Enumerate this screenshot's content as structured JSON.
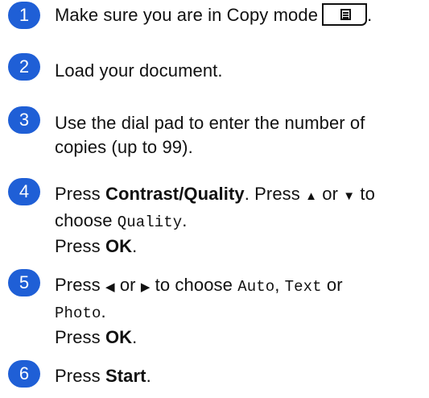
{
  "steps": [
    {
      "number": "1",
      "text_before": "Make sure you are in Copy mode",
      "button_icon": "copy-mode-icon",
      "text_after": "."
    },
    {
      "number": "2",
      "text": "Load your document."
    },
    {
      "number": "3",
      "line1": "Use the dial pad to enter the number of",
      "line2": "copies (up to 99)."
    },
    {
      "number": "4",
      "press": "Press",
      "button": "Contrast/Quality",
      "sep": ". Press",
      "up": "▲",
      "or": "or",
      "down": "▼",
      "to": "to",
      "choose": "choose",
      "option": "Quality",
      "period": ".",
      "press2": "Press",
      "ok": "OK",
      "period2": "."
    },
    {
      "number": "5",
      "press": "Press",
      "left": "◀",
      "or": "or",
      "right": "▶",
      "to_choose": "to choose",
      "opt1": "Auto",
      "comma": ",",
      "opt2": "Text",
      "or2": "or",
      "opt3": "Photo",
      "period": ".",
      "press2": "Press",
      "ok": "OK",
      "period2": "."
    },
    {
      "number": "6",
      "press": "Press",
      "button": "Start",
      "period": "."
    }
  ],
  "colors": {
    "badge": "#1f5fd6",
    "text": "#111111"
  }
}
